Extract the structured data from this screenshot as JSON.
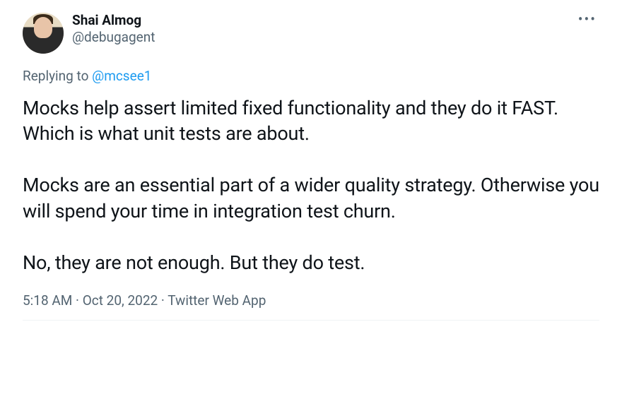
{
  "author": {
    "display_name": "Shai Almog",
    "handle": "@debugagent"
  },
  "reply": {
    "prefix": "Replying to ",
    "target_handle": "@mcsee1"
  },
  "body": "Mocks help assert limited fixed functionality and they do it FAST. Which is what unit tests are about.\n\nMocks are an essential part of a wider quality strategy. Otherwise you will spend your time in integration test churn.\n\nNo, they are not enough. But they do test.",
  "meta": {
    "time": "5:18 AM",
    "separator1": " · ",
    "date": "Oct 20, 2022",
    "separator2": " · ",
    "source": "Twitter Web App"
  },
  "more_glyph": "•••"
}
